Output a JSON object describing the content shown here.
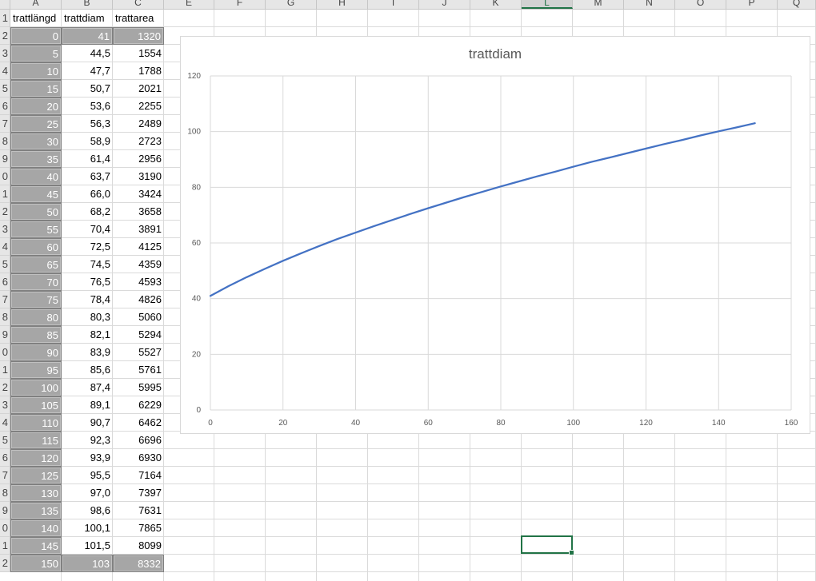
{
  "columns": [
    "A",
    "B",
    "C",
    "E",
    "F",
    "G",
    "H",
    "I",
    "J",
    "K",
    "L",
    "M",
    "N",
    "O",
    "P",
    "Q"
  ],
  "active_column": "L",
  "rows": [
    "1",
    "2",
    "3",
    "4",
    "5",
    "6",
    "7",
    "8",
    "9",
    "0",
    "1",
    "2",
    "3",
    "4",
    "5",
    "6",
    "7",
    "8",
    "9",
    "0",
    "1",
    "2",
    "3",
    "4",
    "5",
    "6",
    "7",
    "8",
    "9",
    "0",
    "1",
    "2"
  ],
  "table": {
    "headers": [
      "trattlängd",
      "trattdiam",
      "trattarea"
    ],
    "data": [
      [
        "0",
        "41",
        "1320"
      ],
      [
        "5",
        "44,5",
        "1554"
      ],
      [
        "10",
        "47,7",
        "1788"
      ],
      [
        "15",
        "50,7",
        "2021"
      ],
      [
        "20",
        "53,6",
        "2255"
      ],
      [
        "25",
        "56,3",
        "2489"
      ],
      [
        "30",
        "58,9",
        "2723"
      ],
      [
        "35",
        "61,4",
        "2956"
      ],
      [
        "40",
        "63,7",
        "3190"
      ],
      [
        "45",
        "66,0",
        "3424"
      ],
      [
        "50",
        "68,2",
        "3658"
      ],
      [
        "55",
        "70,4",
        "3891"
      ],
      [
        "60",
        "72,5",
        "4125"
      ],
      [
        "65",
        "74,5",
        "4359"
      ],
      [
        "70",
        "76,5",
        "4593"
      ],
      [
        "75",
        "78,4",
        "4826"
      ],
      [
        "80",
        "80,3",
        "5060"
      ],
      [
        "85",
        "82,1",
        "5294"
      ],
      [
        "90",
        "83,9",
        "5527"
      ],
      [
        "95",
        "85,6",
        "5761"
      ],
      [
        "100",
        "87,4",
        "5995"
      ],
      [
        "105",
        "89,1",
        "6229"
      ],
      [
        "110",
        "90,7",
        "6462"
      ],
      [
        "115",
        "92,3",
        "6696"
      ],
      [
        "120",
        "93,9",
        "6930"
      ],
      [
        "125",
        "95,5",
        "7164"
      ],
      [
        "130",
        "97,0",
        "7397"
      ],
      [
        "135",
        "98,6",
        "7631"
      ],
      [
        "140",
        "100,1",
        "7865"
      ],
      [
        "145",
        "101,5",
        "8099"
      ],
      [
        "150",
        "103",
        "8332"
      ]
    ]
  },
  "chart_data": {
    "type": "line",
    "title": "trattdiam",
    "xlabel": "",
    "ylabel": "",
    "xlim": [
      0,
      160
    ],
    "ylim": [
      0,
      120
    ],
    "x_ticks": [
      0,
      20,
      40,
      60,
      80,
      100,
      120,
      140,
      160
    ],
    "y_ticks": [
      0,
      20,
      40,
      60,
      80,
      100,
      120
    ],
    "grid": true,
    "color": "#4472c4",
    "series": [
      {
        "x": [
          0,
          5,
          10,
          15,
          20,
          25,
          30,
          35,
          40,
          45,
          50,
          55,
          60,
          65,
          70,
          75,
          80,
          85,
          90,
          95,
          100,
          105,
          110,
          115,
          120,
          125,
          130,
          135,
          140,
          145,
          150
        ],
        "values": [
          41,
          44.5,
          47.7,
          50.7,
          53.6,
          56.3,
          58.9,
          61.4,
          63.7,
          66.0,
          68.2,
          70.4,
          72.5,
          74.5,
          76.5,
          78.4,
          80.3,
          82.1,
          83.9,
          85.6,
          87.4,
          89.1,
          90.7,
          92.3,
          93.9,
          95.5,
          97.0,
          98.6,
          100.1,
          101.5,
          103
        ]
      }
    ]
  },
  "colors": {
    "selection": "#217346",
    "highlight_cell": "#a6a6a6",
    "series_line": "#4472c4"
  }
}
